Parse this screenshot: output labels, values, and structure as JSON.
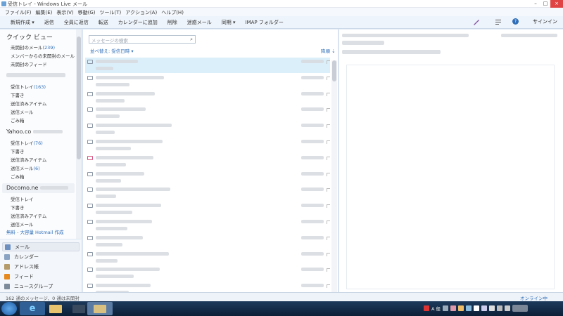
{
  "window": {
    "title": "受信トレイ - Windows Live メール",
    "controls": [
      "–",
      "□",
      "×"
    ]
  },
  "menu": [
    "ファイル(F)",
    "編集(E)",
    "表示(V)",
    "移動(G)",
    "ツール(T)",
    "アクション(A)",
    "ヘルプ(H)"
  ],
  "toolbar": {
    "buttons": [
      "新規作成 ▾",
      "返信",
      "全員に返信",
      "転送",
      "カレンダーに追加",
      "削除",
      "迷惑メール",
      "同期 ▾",
      "IMAP フォルダー"
    ],
    "signin": "サインイン",
    "help_glyph": "?"
  },
  "quick_view": {
    "title": "クイック ビュー",
    "items": [
      {
        "label": "未開封のメール",
        "count": "(239)"
      },
      {
        "label": "メンバーからの未開封のメール",
        "count": ""
      },
      {
        "label": "未開封のフィード",
        "count": ""
      }
    ]
  },
  "accounts": [
    {
      "name": "",
      "folders": [
        {
          "label": "受信トレイ",
          "count": "(163)"
        },
        {
          "label": "下書き",
          "count": ""
        },
        {
          "label": "送信済みアイテム",
          "count": ""
        },
        {
          "label": "送信メール",
          "count": ""
        },
        {
          "label": "ごみ箱",
          "count": ""
        }
      ]
    },
    {
      "name": "Yahoo.co",
      "folders": [
        {
          "label": "受信トレイ",
          "count": "(76)"
        },
        {
          "label": "下書き",
          "count": ""
        },
        {
          "label": "送信済みアイテム",
          "count": ""
        },
        {
          "label": "送信メール",
          "count": "(6)"
        },
        {
          "label": "ごみ箱",
          "count": ""
        }
      ]
    },
    {
      "name": "Docomo.ne",
      "folders": [
        {
          "label": "受信トレイ",
          "count": ""
        },
        {
          "label": "下書き",
          "count": ""
        },
        {
          "label": "送信済みアイテム",
          "count": ""
        },
        {
          "label": "送信メール",
          "count": ""
        }
      ]
    }
  ],
  "hotmail_link": "無料 - 大容量 Hotmail 作成",
  "nav": [
    {
      "label": "メール",
      "icon": "mail-icon",
      "selected": true
    },
    {
      "label": "カレンダー",
      "icon": "calendar-icon",
      "selected": false
    },
    {
      "label": "アドレス帳",
      "icon": "contacts-icon",
      "selected": false
    },
    {
      "label": "フィード",
      "icon": "feed-icon",
      "selected": false
    },
    {
      "label": "ニュースグループ",
      "icon": "newsgroup-icon",
      "selected": false
    }
  ],
  "message_list": {
    "search_placeholder": "メッセージの検索",
    "sort_label": "並べ替え: 受信日時 ▾",
    "sort_direction": "降順 ⇣",
    "row_count": 15
  },
  "status": {
    "text": "162 通のメッセージ、0 通は未開封",
    "online": "オンライン中"
  },
  "taskbar": {
    "tray_text": "A 般",
    "colors": {
      "bar": "#1d3a5c",
      "accent": "#2f6eb8"
    }
  }
}
